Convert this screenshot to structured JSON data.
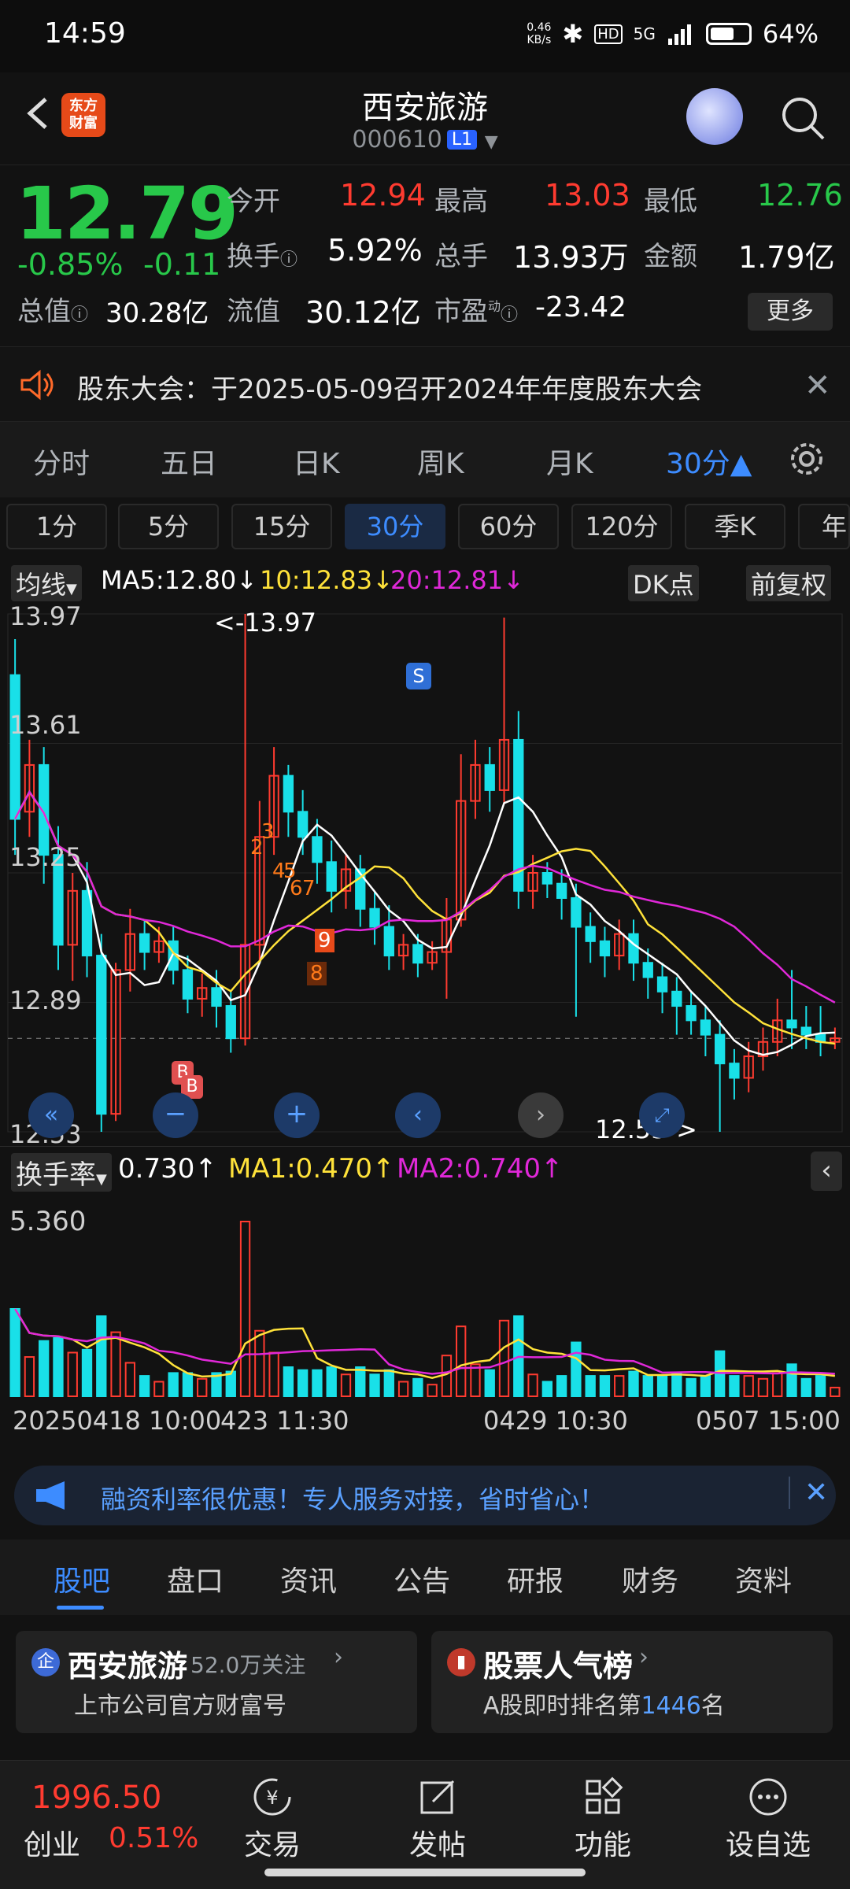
{
  "status_bar": {
    "time": "14:59",
    "net_speed_value": "0.46",
    "net_speed_unit": "KB/s",
    "signal": "5G",
    "battery": "64%",
    "battery_level": 0.64
  },
  "header": {
    "logo_line1": "东方",
    "logo_line2": "财富",
    "stock_name": "西安旅游",
    "stock_code": "000610",
    "level_badge": "L1"
  },
  "quote": {
    "price": "12.79",
    "pct_change": "-0.85%",
    "change": "-0.11",
    "open_label": "今开",
    "open": "12.94",
    "high_label": "最高",
    "high": "13.03",
    "low_label": "最低",
    "low": "12.76",
    "turnover_label": "换手",
    "turnover": "5.92%",
    "volume_label": "总手",
    "volume": "13.93万",
    "amount_label": "金额",
    "amount": "1.79亿",
    "mktcap_label": "总值",
    "mktcap": "30.28亿",
    "float_label": "流值",
    "float_cap": "30.12亿",
    "pe_label": "市盈",
    "pe_sup": "动",
    "pe": "-23.42",
    "more_label": "更多"
  },
  "notice": {
    "text": "股东大会：于2025-05-09召开2024年年度股东大会"
  },
  "period_tabs": [
    {
      "label": "分时"
    },
    {
      "label": "五日"
    },
    {
      "label": "日K"
    },
    {
      "label": "周K"
    },
    {
      "label": "月K"
    },
    {
      "label": "30分▲"
    }
  ],
  "sub_tabs": [
    {
      "label": "1分"
    },
    {
      "label": "5分"
    },
    {
      "label": "15分"
    },
    {
      "label": "30分"
    },
    {
      "label": "60分"
    },
    {
      "label": "120分"
    },
    {
      "label": "季K"
    },
    {
      "label": "年"
    }
  ],
  "ma_legend": {
    "selector": "均线",
    "ma5": "MA5:12.80↓",
    "ma10": "10:12.83↓",
    "ma20": "20:12.81↓",
    "dk_label": "DK点",
    "adjust_label": "前复权"
  },
  "kchart_labels": {
    "y_top": "13.97",
    "y_2": "13.61",
    "y_3": "13.25",
    "y_4": "12.89",
    "y_bottom": "12.53",
    "max_marker": "<-13.97",
    "min_marker": "12.53->",
    "sell_marker": "S",
    "buy_marker_1": "B",
    "buy_marker_2": "B",
    "seq": [
      "2",
      "3",
      "4",
      "5",
      "6",
      "7",
      "8",
      "9"
    ]
  },
  "vol_legend": {
    "selector": "换手率",
    "value": "0.730↑",
    "ma1": "MA1:0.470↑",
    "ma2": "MA2:0.740↑",
    "y_top": "5.360"
  },
  "date_axis": {
    "d1": "20250418 10:00",
    "d2": "423 11:30",
    "d3": "0429 10:30",
    "d4": "0507 15:00"
  },
  "promo": {
    "text": "融资利率很优惠！专人服务对接，省时省心！"
  },
  "bottom_tabs": [
    {
      "label": "股吧"
    },
    {
      "label": "盘口"
    },
    {
      "label": "资讯"
    },
    {
      "label": "公告"
    },
    {
      "label": "研报"
    },
    {
      "label": "财务"
    },
    {
      "label": "资料"
    }
  ],
  "cards": {
    "left_title": "西安旅游",
    "left_follow": "52.0万关注",
    "left_sub": "上市公司官方财富号",
    "right_title": "股票人气榜",
    "right_sub_prefix": "A股即时排名第",
    "right_rank": "1446",
    "right_sub_suffix": "名"
  },
  "bottom_nav": {
    "index_value": "1996.50",
    "index_name": "创业",
    "index_pct": "0.51%",
    "trade": "交易",
    "post": "发帖",
    "function": "功能",
    "watchlist": "设自选"
  },
  "colors": {
    "up": "#ff3b30",
    "down": "#28c84a",
    "accent": "#3d8cff",
    "ma5": "#ffffff",
    "ma10": "#ffe23a",
    "ma20": "#e028d8",
    "candle_down": "#19e0e8"
  },
  "chart_data": {
    "type": "candlestick",
    "interval": "30分",
    "ylim": [
      12.53,
      13.97
    ],
    "yticks": [
      13.97,
      13.61,
      13.25,
      12.89,
      12.53
    ],
    "x_ticks": [
      "20250418 10:00",
      "423 11:30",
      "0429 10:30",
      "0507 15:00"
    ],
    "high_marker": 13.97,
    "low_marker": 12.53,
    "candles": [
      [
        13.8,
        13.4,
        13.9,
        13.3
      ],
      [
        13.42,
        13.55,
        13.62,
        13.35
      ],
      [
        13.55,
        13.3,
        13.6,
        13.22
      ],
      [
        13.3,
        13.05,
        13.38,
        12.98
      ],
      [
        13.05,
        13.2,
        13.25,
        12.95
      ],
      [
        13.2,
        13.02,
        13.28,
        12.96
      ],
      [
        13.02,
        12.58,
        13.08,
        12.53
      ],
      [
        12.58,
        12.98,
        13.0,
        12.56
      ],
      [
        12.98,
        13.08,
        13.15,
        12.92
      ],
      [
        13.08,
        13.03,
        13.12,
        12.98
      ],
      [
        13.03,
        13.06,
        13.1,
        13.0
      ],
      [
        13.06,
        12.98,
        13.1,
        12.94
      ],
      [
        12.98,
        12.9,
        13.02,
        12.86
      ],
      [
        12.9,
        12.93,
        12.97,
        12.85
      ],
      [
        12.93,
        12.88,
        12.98,
        12.82
      ],
      [
        12.88,
        12.79,
        12.92,
        12.75
      ],
      [
        12.79,
        13.05,
        13.97,
        12.77
      ],
      [
        13.05,
        13.35,
        13.45,
        13.0
      ],
      [
        13.35,
        13.52,
        13.6,
        13.3
      ],
      [
        13.52,
        13.42,
        13.55,
        13.35
      ],
      [
        13.42,
        13.35,
        13.48,
        13.3
      ],
      [
        13.35,
        13.28,
        13.4,
        13.22
      ],
      [
        13.28,
        13.2,
        13.34,
        13.14
      ],
      [
        13.2,
        13.26,
        13.3,
        13.15
      ],
      [
        13.26,
        13.15,
        13.3,
        13.1
      ],
      [
        13.15,
        13.1,
        13.2,
        13.05
      ],
      [
        13.1,
        13.02,
        13.16,
        12.98
      ],
      [
        13.02,
        13.05,
        13.08,
        12.98
      ],
      [
        13.05,
        13.0,
        13.08,
        12.96
      ],
      [
        13.0,
        13.03,
        13.06,
        12.98
      ],
      [
        13.03,
        13.12,
        13.18,
        12.9
      ],
      [
        13.12,
        13.45,
        13.58,
        13.1
      ],
      [
        13.45,
        13.55,
        13.62,
        13.4
      ],
      [
        13.55,
        13.48,
        13.6,
        13.42
      ],
      [
        13.48,
        13.62,
        13.96,
        13.44
      ],
      [
        13.62,
        13.2,
        13.7,
        13.15
      ],
      [
        13.2,
        13.25,
        13.3,
        13.15
      ],
      [
        13.25,
        13.22,
        13.28,
        13.18
      ],
      [
        13.22,
        13.18,
        13.26,
        13.12
      ],
      [
        13.18,
        13.1,
        13.22,
        12.85
      ],
      [
        13.1,
        13.06,
        13.14,
        13.0
      ],
      [
        13.06,
        13.02,
        13.1,
        12.96
      ],
      [
        13.02,
        13.08,
        13.12,
        12.98
      ],
      [
        13.08,
        13.0,
        13.12,
        12.95
      ],
      [
        13.0,
        12.96,
        13.04,
        12.9
      ],
      [
        12.96,
        12.92,
        13.0,
        12.86
      ],
      [
        12.92,
        12.88,
        12.96,
        12.8
      ],
      [
        12.88,
        12.84,
        12.92,
        12.8
      ],
      [
        12.84,
        12.8,
        12.88,
        12.74
      ],
      [
        12.8,
        12.72,
        12.84,
        12.53
      ],
      [
        12.72,
        12.68,
        12.76,
        12.62
      ],
      [
        12.68,
        12.74,
        12.78,
        12.64
      ],
      [
        12.74,
        12.78,
        12.82,
        12.7
      ],
      [
        12.78,
        12.84,
        12.9,
        12.74
      ],
      [
        12.84,
        12.82,
        12.98,
        12.76
      ],
      [
        12.82,
        12.8,
        12.88,
        12.76
      ],
      [
        12.8,
        12.78,
        12.88,
        12.74
      ],
      [
        12.78,
        12.79,
        12.82,
        12.76
      ]
    ]
  }
}
